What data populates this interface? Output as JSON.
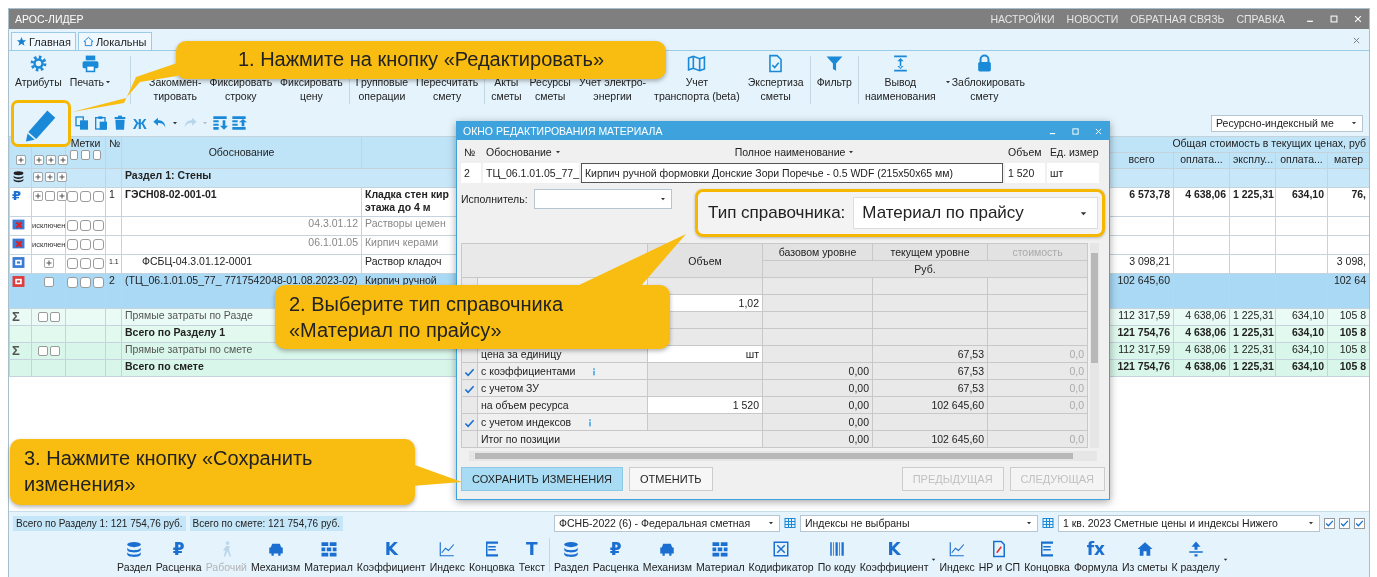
{
  "window": {
    "title": "АРОС-ЛИДЕР",
    "menu": [
      "НАСТРОЙКИ",
      "НОВОСТИ",
      "ОБРАТНАЯ СВЯЗЬ",
      "СПРАВКА"
    ]
  },
  "tabs": [
    {
      "label": "Главная",
      "selected": false
    },
    {
      "label": "Локальны",
      "selected": false
    }
  ],
  "ribbon": [
    {
      "lines": [
        "Атрибуты"
      ]
    },
    {
      "lines": [
        "Печать"
      ],
      "dropdown": true
    },
    {
      "lines": [
        "Закоммен-",
        "тировать"
      ],
      "separator_before": true
    },
    {
      "lines": [
        "Фиксировать",
        "строку"
      ]
    },
    {
      "lines": [
        "Фиксировать",
        "цену"
      ]
    },
    {
      "lines": [
        "Групповые",
        "операции"
      ],
      "separator_before": true
    },
    {
      "lines": [
        "Пересчитать",
        "смету"
      ]
    },
    {
      "lines": [
        "Акты",
        "сметы"
      ],
      "separator_before": true
    },
    {
      "lines": [
        "Ресурсы",
        "сметы"
      ]
    },
    {
      "lines": [
        "Учет электро-",
        "энергии"
      ]
    },
    {
      "lines": [
        "Учет",
        "транспорта (beta)"
      ]
    },
    {
      "lines": [
        "Экспертиза",
        "сметы"
      ]
    },
    {
      "lines": [
        "Фильтр"
      ],
      "separator_before": true
    },
    {
      "lines": [
        "Вывод",
        "наименования"
      ],
      "separator_before": true
    },
    {
      "lines": [
        "Заблокировать",
        "смету"
      ],
      "dropdown_left": true
    }
  ],
  "toolbar": {
    "bold_glyph": "Ж",
    "view_select": "Ресурсно-индексный ме"
  },
  "table": {
    "marks_header": "Метки",
    "number_header": "№",
    "code_header": "Обоснование",
    "cost_header": "Общая стоимость в текущих ценах, руб",
    "cost_columns": [
      "всего",
      "оплата...",
      "эксплу...",
      "оплата...",
      "матер"
    ],
    "rows": [
      {
        "kind": "section",
        "code": "Раздел 1: Стены",
        "selected": false
      },
      {
        "kind": "rate",
        "glyph": "₽",
        "number": "1",
        "code": "ГЭСН08-02-001-01",
        "name_lines": [
          "Кладка стен кир",
          "этажа до 4 м"
        ],
        "selected": false,
        "marks": [
          false,
          false,
          false
        ],
        "costs": {
          "total": "6 573,78",
          "wages": "4 638,06",
          "machines": "1 225,31",
          "machine_wages": "634,10",
          "materials": "76,"
        }
      },
      {
        "kind": "excluded",
        "status": "исключен",
        "code": "04.3.01.12",
        "name_lines": [
          "Растворы цемен"
        ],
        "selected": false,
        "marks": [
          false,
          false,
          false
        ]
      },
      {
        "kind": "excluded",
        "status": "исключен",
        "code": "06.1.01.05",
        "name_lines": [
          "Кирпич керами"
        ],
        "selected": false,
        "marks": [
          false,
          false,
          false
        ]
      },
      {
        "kind": "resource",
        "number": "1.1",
        "code": "ФСБЦ-04.3.01.12-0001",
        "name_lines": [
          "Раствор кладоч"
        ],
        "selected": false,
        "marks": [
          false,
          false,
          false
        ],
        "costs": {
          "total": "3 098,21",
          "materials": "3 098,"
        }
      },
      {
        "kind": "material",
        "number": "2",
        "code": "(ТЦ_06.1.01.05_77_ 7717542048-01.08.2023-02)",
        "name_lines": [
          "Кирпич ручной"
        ],
        "selected": true,
        "marks": [
          false,
          false,
          false
        ],
        "costs": {
          "total": "102 645,60",
          "materials": "102 64"
        }
      },
      {
        "kind": "sum",
        "glyph": "Σ",
        "code": "Прямые затраты по Разде",
        "selected": false,
        "costs": {
          "total": "112 317,59",
          "wages": "4 638,06",
          "machines": "1 225,31",
          "machine_wages": "634,10",
          "materials": "105 8"
        }
      },
      {
        "kind": "total",
        "code": "Всего по Разделу 1",
        "selected": false,
        "costs": {
          "total": "121 754,76",
          "wages": "4 638,06",
          "machines": "1 225,31",
          "machine_wages": "634,10",
          "materials": "105 8"
        }
      },
      {
        "kind": "sum2",
        "glyph": "Σ",
        "code": "Прямые затраты по смете",
        "selected": false,
        "costs": {
          "total": "112 317,59",
          "wages": "4 638,06",
          "machines": "1 225,31",
          "machine_wages": "634,10",
          "materials": "105 8"
        }
      },
      {
        "kind": "total2",
        "code": "Всего по смете",
        "selected": false,
        "costs": {
          "total": "121 754,76",
          "wages": "4 638,06",
          "machines": "1 225,31",
          "machine_wages": "634,10",
          "materials": "105 8"
        }
      }
    ]
  },
  "dialog": {
    "title": "ОКНО РЕДАКТИРОВАНИЯ МАТЕРИАЛА",
    "headers": [
      {
        "label": "№"
      },
      {
        "label": "Обоснование",
        "menu": true
      },
      {
        "label": "Полное наименование",
        "menu": true
      },
      {
        "label": "Объем"
      },
      {
        "label": "Ед. измер"
      }
    ],
    "record": {
      "number": "2",
      "code": "ТЦ_06.1.01.05_77_",
      "name": "Кирпич ручной формовки Донские Зори Поречье - 0.5 WDF (215x50x65 мм)",
      "volume": "1 520",
      "unit": "шт"
    },
    "performer_label": "Исполнитель:",
    "directory_label": "Тип справочника:",
    "directory_value": "Материал по прайсу",
    "grid_headers": [
      "Объем",
      "базовом уровне",
      "текущем уровне",
      "стоимость"
    ],
    "currency": "Руб.",
    "grid_rows": [
      {
        "kind": "blank"
      },
      {
        "kind": "blank",
        "volume": "1,02"
      },
      {
        "kind": "blank"
      },
      {
        "kind": "blank"
      },
      {
        "kind": "plain",
        "label": "цена за единицу",
        "volume": "шт",
        "current": "67,53",
        "cost": "0,0"
      },
      {
        "kind": "check",
        "checked": true,
        "label": "с коэффициентами",
        "info": true,
        "base": "0,00",
        "current": "67,53",
        "cost": "0,0"
      },
      {
        "kind": "check",
        "checked": true,
        "label": "с учетом ЗУ",
        "base": "0,00",
        "current": "67,53",
        "cost": "0,0"
      },
      {
        "kind": "plain",
        "label": "на объем ресурса",
        "volume": "1 520",
        "base": "0,00",
        "current": "102 645,60",
        "cost": "0,0"
      },
      {
        "kind": "check",
        "checked": true,
        "label": "с учетом индексов",
        "info": true,
        "base": "0,00"
      },
      {
        "kind": "total",
        "label": "Итог по позиции",
        "base": "0,00",
        "current": "102 645,60",
        "cost": "0,0"
      }
    ],
    "buttons": [
      {
        "label": "СОХРАНИТЬ ИЗМЕНЕНИЯ",
        "kind": "primary",
        "disabled": false
      },
      {
        "label": "ОТМЕНИТЬ",
        "kind": "normal",
        "disabled": false
      },
      {
        "label": "ПРЕДЫДУЩАЯ",
        "kind": "nav",
        "disabled": true
      },
      {
        "label": "СЛЕДУЮЩАЯ",
        "kind": "nav",
        "disabled": true
      }
    ]
  },
  "status_bar": {
    "totals": [
      "Всего по Разделу 1: 121 754,76 руб.",
      "Всего по смете: 121 754,76 руб."
    ],
    "base_select": "ФСНБ-2022 (6) - Федеральная сметная",
    "index_select": "Индексы не выбраны",
    "price_select": "1 кв. 2023 Сметные цены и индексы Нижего",
    "checks": [
      true,
      true,
      true
    ]
  },
  "bottom_toolbar": [
    {
      "label": "Раздел"
    },
    {
      "label": "Расценка",
      "glyph": "₽"
    },
    {
      "label": "Рабочий",
      "disabled": true
    },
    {
      "label": "Механизм"
    },
    {
      "label": "Материал"
    },
    {
      "label": "Коэффициент",
      "glyph": "K"
    },
    {
      "label": "Индекс"
    },
    {
      "label": "Концовка"
    },
    {
      "label": "Текст",
      "glyph": "T"
    },
    {
      "label": "Раздел",
      "separator_before": true
    },
    {
      "label": "Расценка",
      "glyph": "₽"
    },
    {
      "label": "Механизм"
    },
    {
      "label": "Материал"
    },
    {
      "label": "Кодификатор"
    },
    {
      "label": "По коду"
    },
    {
      "label": "Коэффициент",
      "glyph": "K",
      "dropdown": true
    },
    {
      "label": "Индекс"
    },
    {
      "label": "НР и СП"
    },
    {
      "label": "Концовка"
    },
    {
      "label": "Формула",
      "glyph": "fx"
    },
    {
      "label": "Из сметы"
    },
    {
      "label": "К разделу",
      "dropdown": true
    }
  ],
  "annotations": [
    {
      "text": "1. Нажмите на кнопку «Редактировать»"
    },
    {
      "text": "2. Выберите тип справочника «Материал по прайсу»"
    },
    {
      "text": "3. Нажмите кнопку «Сохранить изменения»"
    }
  ]
}
